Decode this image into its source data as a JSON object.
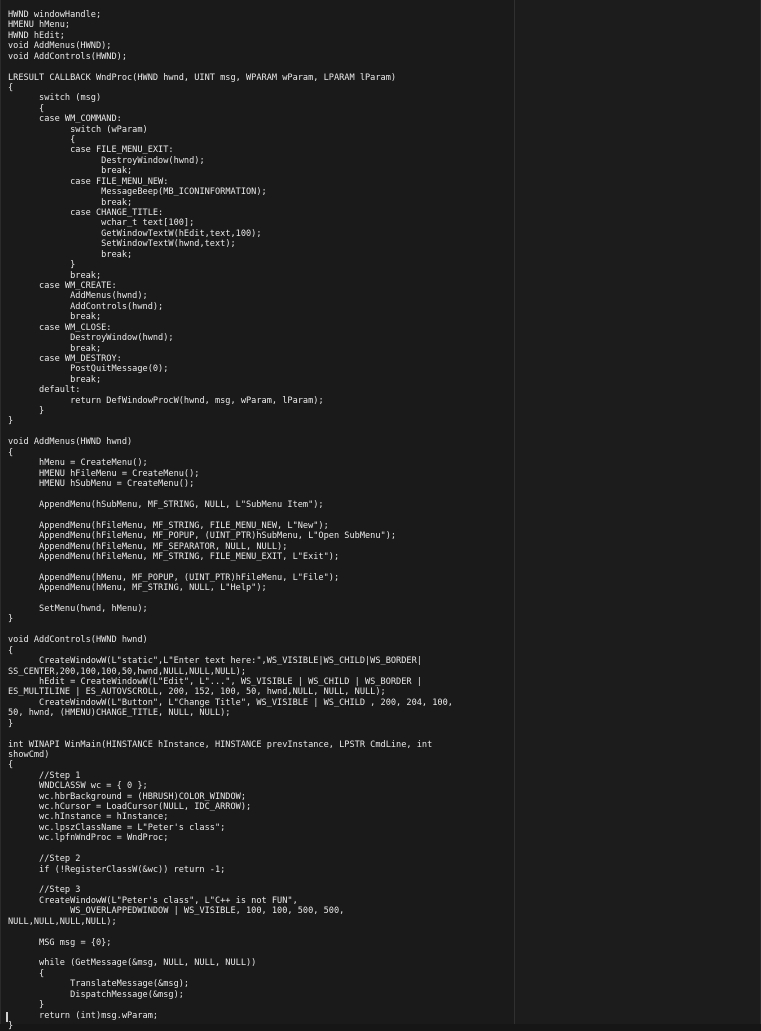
{
  "editor": {
    "code": "HWND windowHandle;\nHMENU hMenu;\nHWND hEdit;\nvoid AddMenus(HWND);\nvoid AddControls(HWND);\n\nLRESULT CALLBACK WndProc(HWND hwnd, UINT msg, WPARAM wParam, LPARAM lParam)\n{\n\tswitch (msg)\n\t{\n\tcase WM_COMMAND:\n\t\tswitch (wParam)\n\t\t{\n\t\tcase FILE_MENU_EXIT:\n\t\t\tDestroyWindow(hwnd);\n\t\t\tbreak;\n\t\tcase FILE_MENU_NEW:\n\t\t\tMessageBeep(MB_ICONINFORMATION);\n\t\t\tbreak;\n\t\tcase CHANGE_TITLE:\n\t\t\twchar_t text[100];\n\t\t\tGetWindowTextW(hEdit,text,100);\n\t\t\tSetWindowTextW(hwnd,text);\n\t\t\tbreak;\n\t\t}\n\t\tbreak;\n\tcase WM_CREATE:\n\t\tAddMenus(hwnd);\n\t\tAddControls(hwnd);\n\t\tbreak;\n\tcase WM_CLOSE:\n\t\tDestroyWindow(hwnd);\n\t\tbreak;\n\tcase WM_DESTROY:\n\t\tPostQuitMessage(0);\n\t\tbreak;\n\tdefault:\n\t\treturn DefWindowProcW(hwnd, msg, wParam, lParam);\n\t}\n}\n\nvoid AddMenus(HWND hwnd)\n{\n\thMenu = CreateMenu();\n\tHMENU hFileMenu = CreateMenu();\n\tHMENU hSubMenu = CreateMenu();\n\n\tAppendMenu(hSubMenu, MF_STRING, NULL, L\"SubMenu Item\");\n\n\tAppendMenu(hFileMenu, MF_STRING, FILE_MENU_NEW, L\"New\");\n\tAppendMenu(hFileMenu, MF_POPUP, (UINT_PTR)hSubMenu, L\"Open SubMenu\");\n\tAppendMenu(hFileMenu, MF_SEPARATOR, NULL, NULL);\n\tAppendMenu(hFileMenu, MF_STRING, FILE_MENU_EXIT, L\"Exit\");\n\n\tAppendMenu(hMenu, MF_POPUP, (UINT_PTR)hFileMenu, L\"File\");\n\tAppendMenu(hMenu, MF_STRING, NULL, L\"Help\");\n\n\tSetMenu(hwnd, hMenu);\n}\n\nvoid AddControls(HWND hwnd)\n{\n\tCreateWindowW(L\"static\",L\"Enter text here:\",WS_VISIBLE|WS_CHILD|WS_BORDER|\nSS_CENTER,200,100,100,50,hwnd,NULL,NULL,NULL);\n\thEdit = CreateWindowW(L\"Edit\", L\"...\", WS_VISIBLE | WS_CHILD | WS_BORDER |\nES_MULTILINE | ES_AUTOVSCROLL, 200, 152, 100, 50, hwnd,NULL, NULL, NULL);\n\tCreateWindowW(L\"Button\", L\"Change Title\", WS_VISIBLE | WS_CHILD , 200, 204, 100,\n50, hwnd, (HMENU)CHANGE_TITLE, NULL, NULL);\n}\n\nint WINAPI WinMain(HINSTANCE hInstance, HINSTANCE prevInstance, LPSTR CmdLine, int\nshowCmd)\n{\n\t//Step 1\n\tWNDCLASSW wc = { 0 };\n\twc.hbrBackground = (HBRUSH)COLOR_WINDOW;\n\twc.hCursor = LoadCursor(NULL, IDC_ARROW);\n\twc.hInstance = hInstance;\n\twc.lpszClassName = L\"Peter's class\";\n\twc.lpfnWndProc = WndProc;\n\n\t//Step 2\n\tif (!RegisterClassW(&wc)) return -1;\n\n\t//Step 3\n\tCreateWindowW(L\"Peter's class\", L\"C++ is not FUN\",\n\t\tWS_OVERLAPPEDWINDOW | WS_VISIBLE, 100, 100, 500, 500,\nNULL,NULL,NULL,NULL);\n\n\tMSG msg = {0};\n\n\twhile (GetMessage(&msg, NULL, NULL, NULL))\n\t{\n\t\tTranslateMessage(&msg);\n\t\tDispatchMessage(&msg);\n\t}\n\treturn (int)msg.wParam;\n}"
  },
  "colors": {
    "background": "#1a1a1a",
    "text": "#eaeaea",
    "spellcheck_underline": "#d14a4a"
  }
}
